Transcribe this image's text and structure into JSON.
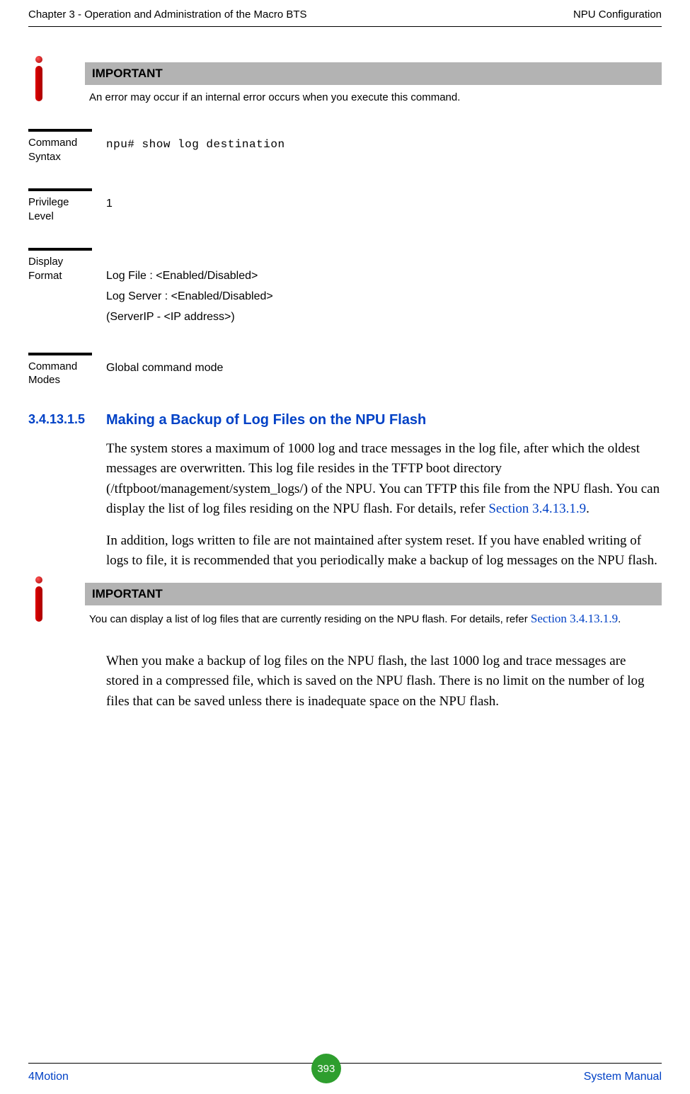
{
  "header": {
    "left": "Chapter 3 - Operation and Administration of the Macro BTS",
    "right": "NPU Configuration"
  },
  "important1": {
    "title": "IMPORTANT",
    "text": "An error may occur if an internal error occurs when you execute this command."
  },
  "defs": {
    "syntax_label": "Command Syntax",
    "syntax_value": "npu# show log destination",
    "priv_label": "Privilege Level",
    "priv_value": "1",
    "disp_label": "Display Format",
    "disp_line1": "Log File   : <Enabled/Disabled>",
    "disp_line2": "Log Server : <Enabled/Disabled>",
    "disp_line3": "(ServerIP - <IP address>)",
    "modes_label": "Command Modes",
    "modes_value": "Global command mode"
  },
  "section": {
    "num": "3.4.13.1.5",
    "title": "Making a Backup of Log Files on the NPU Flash"
  },
  "para1a": "The system stores a maximum of 1000 log and trace messages in the log file, after which the oldest messages are overwritten. This log file resides in the TFTP boot directory (/tftpboot/management/system_logs/) of the NPU. You can TFTP this file from the NPU flash. You can display the list of log files residing on the NPU flash. For details, refer ",
  "para1link": "Section 3.4.13.1.9",
  "para1b": ".",
  "para2": "In addition, logs written to file are not maintained after system reset. If you have enabled writing of logs to file, it is recommended that you periodically make a backup of log messages on the NPU flash.",
  "important2": {
    "title": "IMPORTANT",
    "text_a": "You can display a list of log files that are currently residing on the NPU flash. For details, refer ",
    "text_link": "Section 3.4.13.1.9",
    "text_b": "."
  },
  "para3": "When you make a backup of log files on the NPU flash, the last 1000 log and trace messages are stored in a compressed file, which is saved on the NPU flash. There is no limit on the number of log files that can be saved unless there is inadequate space on the NPU flash.",
  "footer": {
    "left": "4Motion",
    "page": "393",
    "right": "System Manual"
  }
}
